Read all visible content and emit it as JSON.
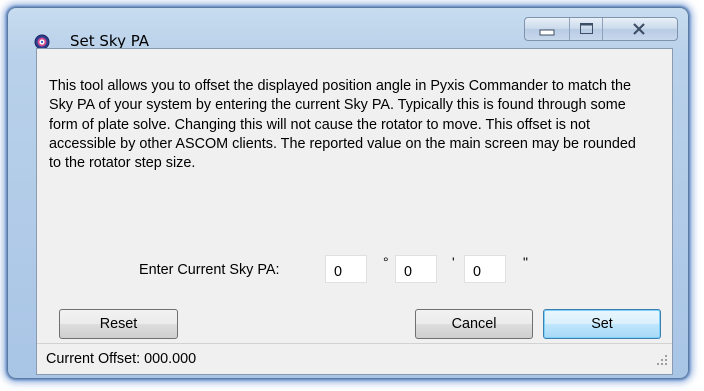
{
  "window": {
    "title": "Set Sky PA",
    "controls": [
      "minimize",
      "maximize",
      "close"
    ]
  },
  "description": "This tool allows you to offset the displayed position angle in Pyxis Commander to match the Sky PA of your system by entering the current Sky PA. Typically this is found through some form of plate solve. Changing this will not cause the rotator to move. This offset is not accessible by other ASCOM clients. The reported value on the main screen may be rounded to the rotator step size.",
  "sky_pa": {
    "label": "Enter Current Sky PA:",
    "degrees": "0",
    "minutes": "0",
    "seconds": "0",
    "degree_symbol": "°",
    "minute_symbol": "'",
    "second_symbol": "\""
  },
  "buttons": {
    "reset": "Reset",
    "cancel": "Cancel",
    "set": "Set"
  },
  "status": {
    "text": "Current Offset: 000.000"
  },
  "icons": {
    "app": "target-icon",
    "minimize": "minimize-icon",
    "maximize": "maximize-icon",
    "close": "close-icon",
    "grip": "resize-grip-icon"
  },
  "colors": {
    "frame": "#a9c5e6",
    "client_bg": "#f0f0f0",
    "default_button": "#bee6fd"
  }
}
